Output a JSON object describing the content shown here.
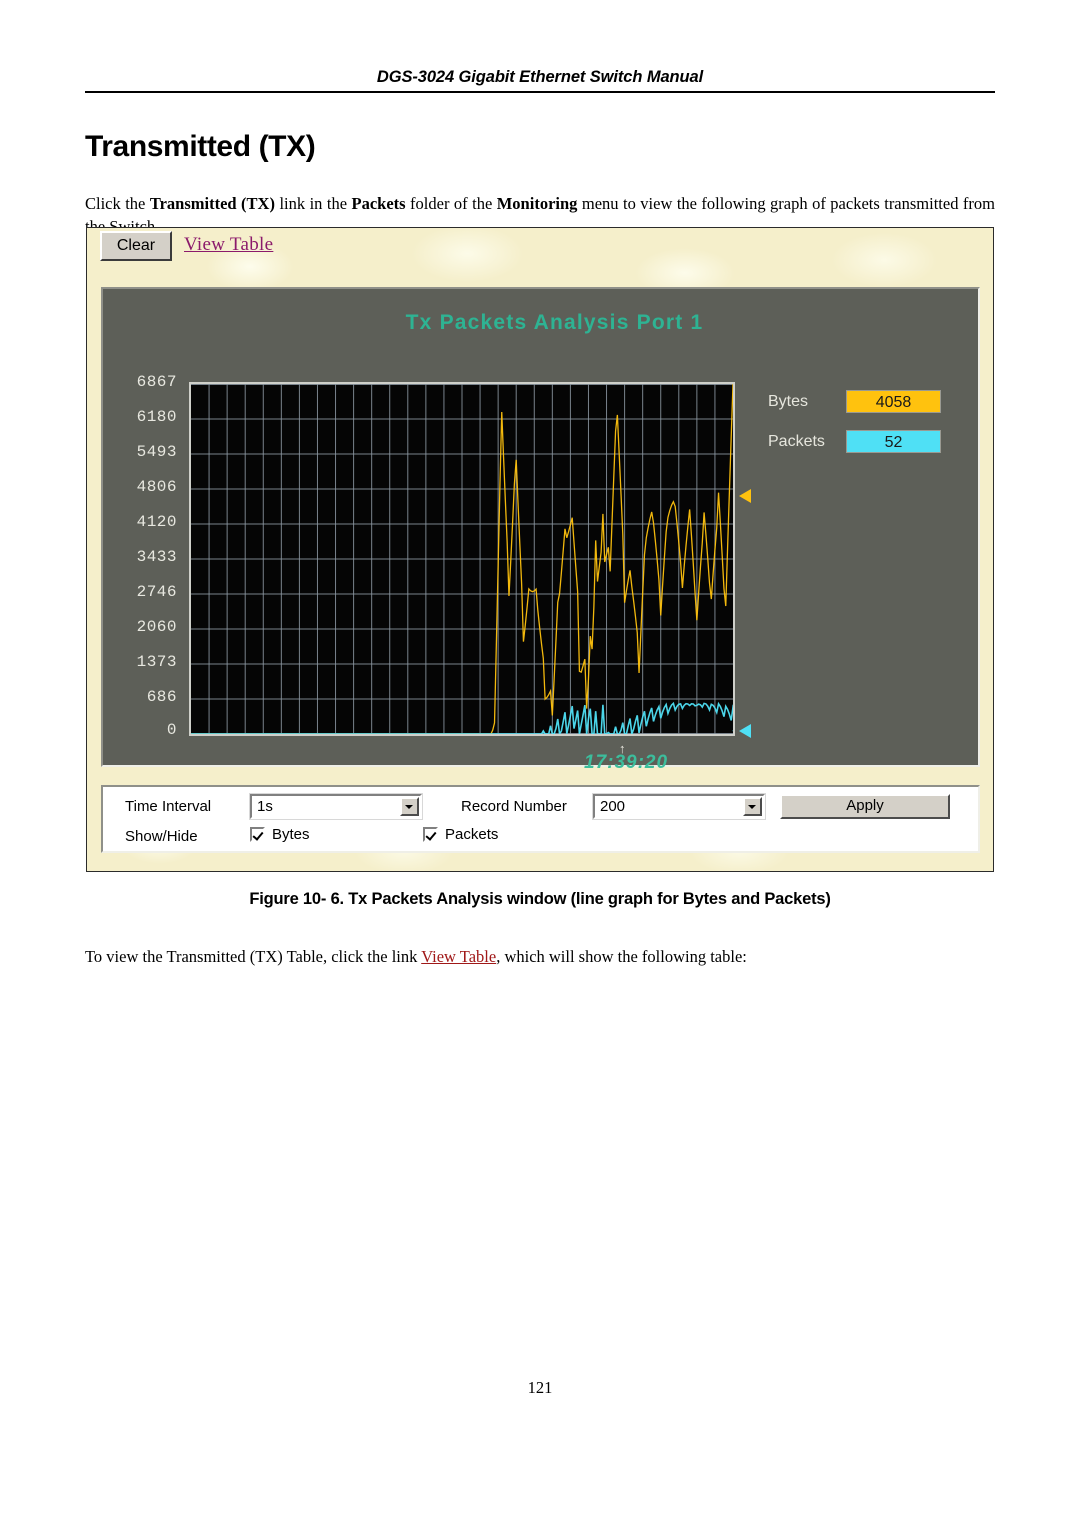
{
  "document": {
    "running_header": "DGS-3024 Gigabit Ethernet Switch Manual",
    "section_heading": "Transmitted (TX)",
    "intro_paragraph_parts": {
      "p1": "Click the ",
      "b1": "Transmitted (TX)",
      "p2": " link in the ",
      "b2": "Packets",
      "p3": " folder of the ",
      "b3": "Monitoring",
      "p4": " menu to view the following graph of packets transmitted from the Switch."
    },
    "figure_caption": "Figure 10- 6. Tx Packets Analysis window (line graph for Bytes and Packets)",
    "closing_paragraph_parts": {
      "p1": "To view the Transmitted (TX) Table, click the link ",
      "link": "View Table",
      "p2": ", which will show the following table:"
    },
    "page_number": "121"
  },
  "app": {
    "toolbar": {
      "clear_label": "Clear",
      "view_table_link": "View Table"
    },
    "chart_title": "Tx Packets Analysis  Port 1",
    "legend": [
      {
        "label": "Bytes",
        "value": "4058",
        "color": "#ffc20e"
      },
      {
        "label": "Packets",
        "value": "52",
        "color": "#4fe0f5"
      }
    ],
    "time_marker": {
      "arrow": "↑",
      "label": "17:39:20"
    },
    "controls": {
      "time_interval_label": "Time Interval",
      "time_interval_value": "1s",
      "record_number_label": "Record Number",
      "record_number_value": "200",
      "apply_label": "Apply",
      "show_hide_label": "Show/Hide",
      "checkbox_bytes_label": "Bytes",
      "checkbox_bytes_checked": true,
      "checkbox_packets_label": "Packets",
      "checkbox_packets_checked": true
    }
  },
  "chart_data": {
    "type": "line",
    "title": "Tx Packets Analysis  Port 1",
    "xlabel": "",
    "ylabel": "",
    "ylim": [
      0,
      6867
    ],
    "grid": true,
    "legend_position": "right",
    "ytick_labels": [
      "6867",
      "6180",
      "5493",
      "4806",
      "4120",
      "3433",
      "2746",
      "2060",
      "1373",
      "686",
      "0"
    ],
    "ytick_values": [
      6867,
      6180,
      5493,
      4806,
      4120,
      3433,
      2746,
      2060,
      1373,
      686,
      0
    ],
    "x_axis_note": "time axis, newest sample at right edge, marker at 17:39:20",
    "vertical_gridlines": 30,
    "series": [
      {
        "name": "Bytes",
        "color": "#ffc20e",
        "current_value": 4058,
        "x": [
          0,
          1,
          2,
          3,
          4,
          5,
          6,
          7,
          8,
          9,
          10,
          11,
          12,
          13,
          14,
          15,
          16,
          17,
          18,
          19,
          20,
          21,
          22,
          23,
          24,
          25,
          26,
          27,
          28,
          29,
          30,
          31,
          32,
          33,
          34,
          35,
          36,
          37,
          38,
          39,
          40,
          41,
          42,
          43,
          44,
          45,
          46,
          47,
          48,
          49,
          50,
          51,
          52,
          53,
          54,
          55,
          56,
          57,
          58,
          59,
          60,
          61,
          62,
          63,
          64,
          65,
          66,
          67,
          68,
          69,
          70,
          71,
          72,
          73,
          74
        ],
        "values": [
          0,
          0,
          0,
          0,
          0,
          0,
          0,
          0,
          0,
          0,
          0,
          0,
          0,
          0,
          0,
          0,
          0,
          0,
          0,
          0,
          0,
          0,
          0,
          0,
          0,
          0,
          0,
          0,
          0,
          0,
          0,
          0,
          0,
          0,
          0,
          0,
          0,
          0,
          0,
          0,
          0,
          0,
          760,
          6867,
          3250,
          5900,
          2300,
          3250,
          2800,
          1000,
          600,
          2900,
          3900,
          3700,
          1050,
          800,
          3400,
          3800,
          3650,
          6600,
          2800,
          3000,
          1200,
          3750,
          3950,
          2050,
          3900,
          4050,
          2400,
          3900,
          1700,
          3800,
          2100,
          4200,
          2000,
          6800
        ],
        "note": "flat at zero for left portion, then rapid oscillation between ~600 and ~6867 in the right third of the plot"
      },
      {
        "name": "Packets",
        "color": "#4fe0f5",
        "current_value": 52,
        "x": [
          0,
          1,
          2,
          3,
          4,
          5,
          6,
          7,
          8,
          9,
          10,
          11,
          12,
          13,
          14,
          15,
          16,
          17,
          18,
          19,
          20,
          21,
          22,
          23,
          24,
          25,
          26,
          27,
          28,
          29,
          30,
          31,
          32,
          33,
          34,
          35,
          36,
          37,
          38,
          39,
          40,
          41,
          42,
          43,
          44,
          45,
          46,
          47,
          48,
          49,
          50,
          51,
          52,
          53,
          54,
          55,
          56,
          57,
          58,
          59,
          60,
          61,
          62,
          63,
          64,
          65,
          66,
          67,
          68,
          69,
          70,
          71,
          72,
          73,
          74
        ],
        "values": [
          0,
          0,
          0,
          0,
          0,
          0,
          0,
          0,
          0,
          0,
          0,
          0,
          0,
          0,
          0,
          0,
          0,
          0,
          0,
          0,
          0,
          0,
          0,
          0,
          0,
          0,
          0,
          0,
          0,
          0,
          0,
          0,
          0,
          0,
          0,
          0,
          0,
          0,
          0,
          0,
          0,
          0,
          30,
          70,
          45,
          62,
          38,
          48,
          41,
          22,
          18,
          44,
          55,
          52,
          24,
          20,
          50,
          54,
          51,
          68,
          42,
          44,
          25,
          52,
          55,
          33,
          54,
          56,
          36,
          54,
          30,
          53,
          34,
          56,
          32,
          52
        ],
        "note": "near-flat cyan trace hugging the baseline, values roughly 18-70 packets"
      }
    ]
  }
}
